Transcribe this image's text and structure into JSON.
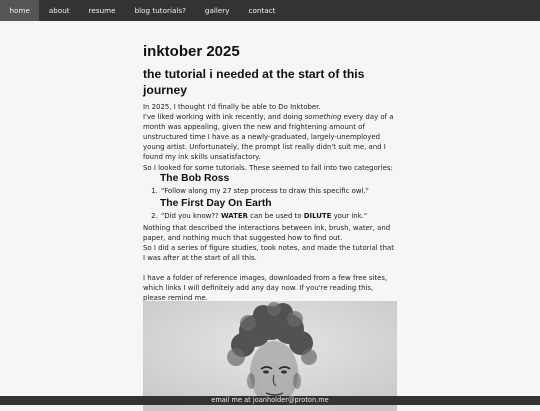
{
  "nav": {
    "items": [
      {
        "label": "home",
        "active": true
      },
      {
        "label": "about",
        "active": false
      },
      {
        "label": "resume",
        "active": false
      },
      {
        "label": "blog tutorials?",
        "active": false
      },
      {
        "label": "gallery",
        "active": false
      },
      {
        "label": "contact",
        "active": false
      }
    ]
  },
  "article": {
    "title": "inktober 2025",
    "subtitle": "the tutorial i needed at the start of this journey",
    "p1": "In 2025, I thought I'd finally be able to Do Inktober.",
    "p2_pre": "I've liked working with ink recently, and doing ",
    "p2_em": "something",
    "p2_post": " every day of a month was appealing, given the new and frightening amount of unstructured time I have as a newly-graduated, largely-unemployed young artist. Unfortunately, the prompt list really didn't suit me, and I found my ink skills unsatisfactory.",
    "p3": "So I looked for some tutorials. These seemed to fall into two categories:",
    "section1": "The Bob Ross",
    "item1": "\"Follow along my 27 step process to draw this specific owl.\"",
    "section2": "The First Day On Earth",
    "item2_a": "\"Did you know?? ",
    "item2_b": "WATER",
    "item2_c": " can be used to ",
    "item2_d": "DILUTE",
    "item2_e": " your ink.\"",
    "p4": "Nothing that described the interactions between ink, brush, water, and paper, and nothing much that suggested how to find out.",
    "p5": "So I did a series of figure studies, took notes, and made the tutorial that I was after at the start of all this.",
    "p6": "I have a folder of reference images, downloaded from a few free sites, which links I will definitely add any day now. If you're reading this, please remind me."
  },
  "footer": {
    "text": "email me at joanholder@proton.me"
  }
}
